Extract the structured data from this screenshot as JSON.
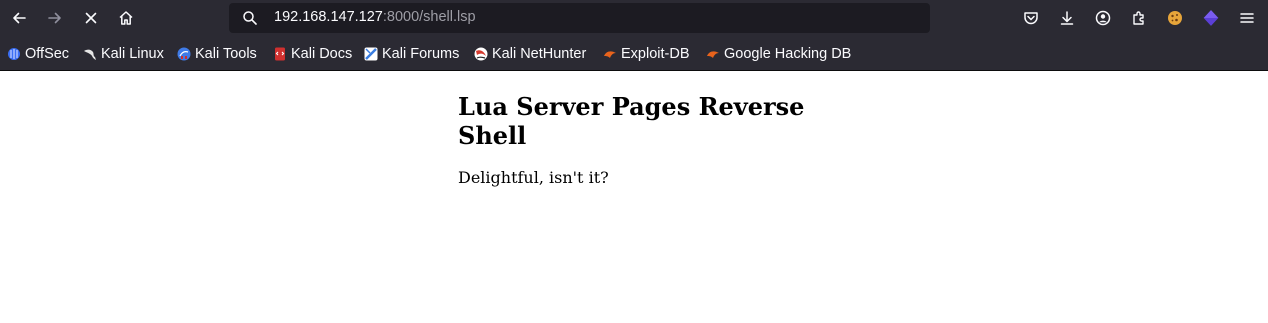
{
  "browser": {
    "url_host": "192.168.147.127",
    "url_path": ":8000/shell.lsp",
    "toolbar_icons": [
      "back-icon",
      "forward-icon",
      "stop-icon",
      "home-icon",
      "search-icon",
      "pocket-icon",
      "downloads-icon",
      "account-icon",
      "extensions-icon",
      "extension-cookie-icon",
      "extension-cube-icon",
      "menu-icon"
    ]
  },
  "bookmarks": [
    {
      "label": "OffSec",
      "icon": "offsec-icon",
      "color": "#3b6ff5"
    },
    {
      "label": "Kali Linux",
      "icon": "kali-dragon-icon",
      "color": "#dddddd"
    },
    {
      "label": "Kali Tools",
      "icon": "kali-tools-icon",
      "color": "#3f7be8"
    },
    {
      "label": "Kali Docs",
      "icon": "kali-docs-icon",
      "color": "#d0302f"
    },
    {
      "label": "Kali Forums",
      "icon": "kali-forums-icon",
      "color": "#3a7de0"
    },
    {
      "label": "Kali NetHunter",
      "icon": "nethunter-icon",
      "color": "#d53a2e"
    },
    {
      "label": "Exploit-DB",
      "icon": "exploit-db-icon",
      "color": "#e8631c"
    },
    {
      "label": "Google Hacking DB",
      "icon": "ghdb-icon",
      "color": "#e8631c"
    }
  ],
  "page": {
    "heading": "Lua Server Pages Reverse Shell",
    "text": "Delightful, isn't it?"
  }
}
